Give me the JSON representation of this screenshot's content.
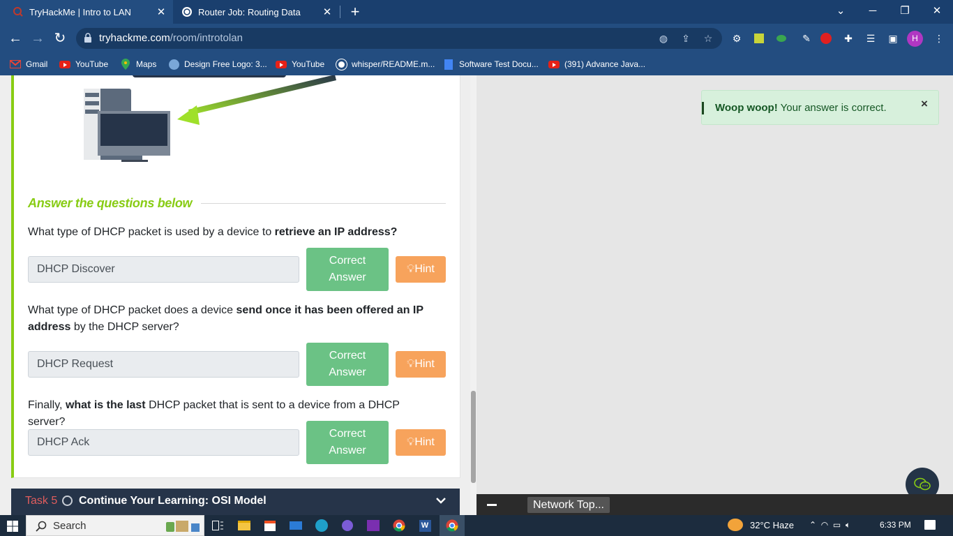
{
  "browser": {
    "tabs": [
      {
        "title": "TryHackMe | Intro to LAN",
        "active": true
      },
      {
        "title": "Router Job: Routing Data",
        "active": false
      }
    ],
    "url_host": "tryhackme.com",
    "url_path": "/room/introtolan",
    "profile_initial": "H",
    "bookmarks": [
      {
        "label": "Gmail",
        "icon": "gmail-icon"
      },
      {
        "label": "YouTube",
        "icon": "youtube-icon"
      },
      {
        "label": "Maps",
        "icon": "maps-icon"
      },
      {
        "label": "Design Free Logo: 3...",
        "icon": "logo-site-icon"
      },
      {
        "label": "YouTube",
        "icon": "youtube-icon"
      },
      {
        "label": "whisper/README.m...",
        "icon": "github-icon"
      },
      {
        "label": "Software Test Docu...",
        "icon": "docs-icon"
      },
      {
        "label": "(391) Advance Java...",
        "icon": "youtube-icon"
      }
    ]
  },
  "room": {
    "section_heading": "Answer the questions below",
    "questions": [
      {
        "parts": [
          {
            "text": "What type of DHCP packet is used by a device to ",
            "bold": false
          },
          {
            "text": "retrieve an IP address?",
            "bold": true
          }
        ],
        "answer": "DHCP Discover"
      },
      {
        "parts": [
          {
            "text": "What type of DHCP packet does a device ",
            "bold": false
          },
          {
            "text": "send once it has been offered an IP address",
            "bold": true
          },
          {
            "text": " by the DHCP server?",
            "bold": false
          }
        ],
        "answer": "DHCP Request"
      },
      {
        "parts": [
          {
            "text": "Finally, ",
            "bold": false
          },
          {
            "text": "what is the last",
            "bold": true
          },
          {
            "text": " DHCP packet that is sent to a device from a DHCP server?",
            "bold": false
          }
        ],
        "answer": "DHCP Ack"
      }
    ],
    "correct_label_line1": "Correct",
    "correct_label_line2": "Answer",
    "hint_label": "Hint",
    "next_task": {
      "number": "Task 5",
      "title": "Continue Your Learning: OSI Model"
    }
  },
  "toast": {
    "bold": "Woop woop!",
    "message": " Your answer is correct.",
    "close": "×"
  },
  "mini_player": {
    "label": "Network Top..."
  },
  "taskbar": {
    "search_placeholder": "Search",
    "weather": "32°C  Haze",
    "time": "6:33 PM"
  },
  "colors": {
    "accent_green": "#88cc14",
    "correct_green": "#6bc285",
    "hint_orange": "#f7a35c",
    "chrome_blue": "#234d80"
  }
}
